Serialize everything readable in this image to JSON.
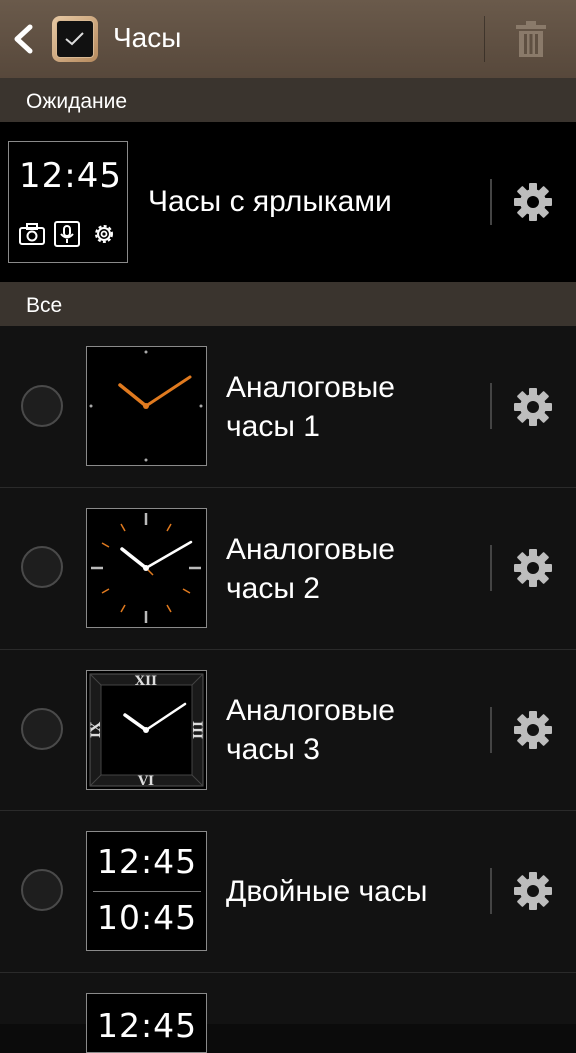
{
  "header": {
    "title": "Часы"
  },
  "sections": {
    "standby": "Ожидание",
    "all": "Все"
  },
  "standby_item": {
    "label": "Часы с ярлыками",
    "time": "12:45"
  },
  "items": [
    {
      "label_line1": "Аналоговые",
      "label_line2": "часы 1"
    },
    {
      "label_line1": "Аналоговые",
      "label_line2": "часы 2"
    },
    {
      "label_line1": "Аналоговые",
      "label_line2": "часы 3"
    },
    {
      "label": "Двойные часы",
      "time1": "12:45",
      "time2": "10:45"
    },
    {
      "time": "12:45"
    }
  ],
  "colors": {
    "appbar": "#5f5042",
    "section": "#3a342e",
    "accent_hand": "#e07a1f"
  }
}
